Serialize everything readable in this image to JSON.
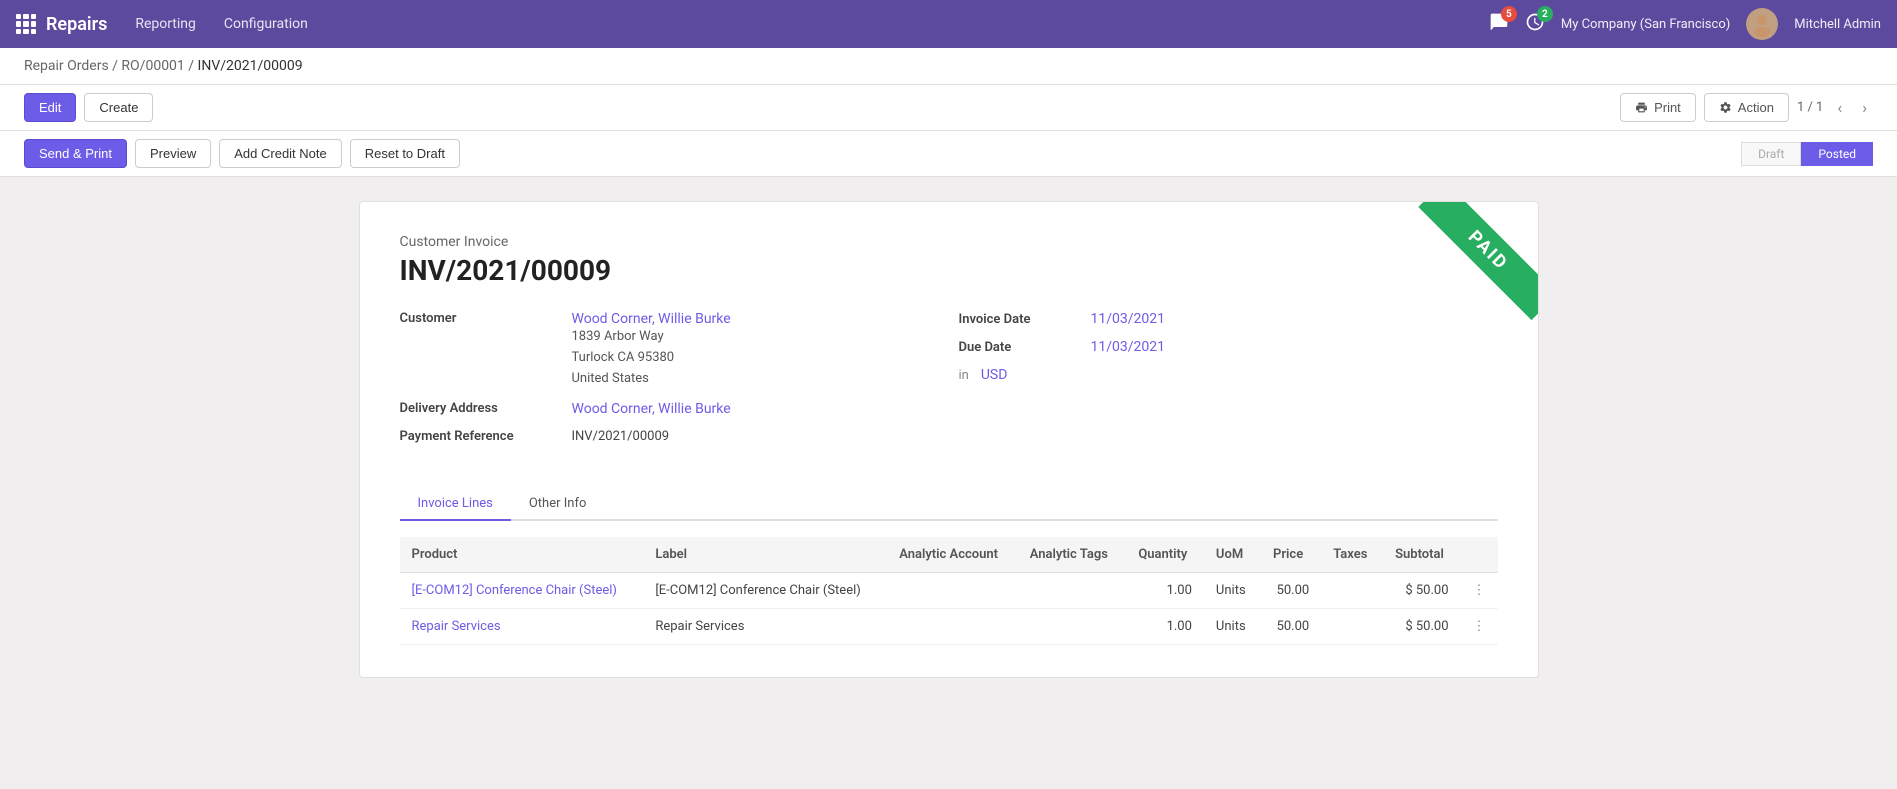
{
  "nav": {
    "app_name": "Repairs",
    "links": [
      "Reporting",
      "Configuration"
    ],
    "notifications": [
      {
        "icon": "chat",
        "count": 5,
        "badge_class": "badge"
      },
      {
        "icon": "clock",
        "count": 2,
        "badge_class": "badge badge-green"
      }
    ],
    "company": "My Company (San Francisco)",
    "user": "Mitchell Admin"
  },
  "breadcrumb": {
    "parts": [
      "Repair Orders",
      "RO/00001",
      "INV/2021/00009"
    ],
    "separators": [
      "/",
      "/"
    ]
  },
  "toolbar": {
    "edit_label": "Edit",
    "create_label": "Create",
    "print_label": "Print",
    "action_label": "Action",
    "pagination": "1 / 1"
  },
  "toolbar2": {
    "send_print_label": "Send & Print",
    "preview_label": "Preview",
    "add_credit_note_label": "Add Credit Note",
    "reset_to_draft_label": "Reset to Draft",
    "statuses": [
      "Draft",
      "Posted"
    ],
    "active_status": "Posted"
  },
  "invoice": {
    "type": "Customer Invoice",
    "number": "INV/2021/00009",
    "customer_label": "Customer",
    "customer_name": "Wood Corner, Willie Burke",
    "customer_address": "1839 Arbor Way\nTurlock CA 95380\nUnited States",
    "delivery_address_label": "Delivery Address",
    "delivery_address": "Wood Corner, Willie Burke",
    "payment_reference_label": "Payment Reference",
    "payment_reference": "INV/2021/00009",
    "invoice_date_label": "Invoice Date",
    "invoice_date": "11/03/2021",
    "due_date_label": "Due Date",
    "due_date": "11/03/2021",
    "currency_prefix": "in",
    "currency": "USD",
    "paid_label": "PAID"
  },
  "tabs": [
    "Invoice Lines",
    "Other Info"
  ],
  "active_tab": "Invoice Lines",
  "table": {
    "columns": [
      "Product",
      "Label",
      "Analytic Account",
      "Analytic Tags",
      "Quantity",
      "UoM",
      "Price",
      "Taxes",
      "Subtotal"
    ],
    "rows": [
      {
        "product": "[E-COM12] Conference Chair (Steel)",
        "label": "[E-COM12] Conference Chair (Steel)",
        "analytic_account": "",
        "analytic_tags": "",
        "quantity": "1.00",
        "uom": "Units",
        "price": "50.00",
        "taxes": "",
        "subtotal": "$ 50.00"
      },
      {
        "product": "Repair Services",
        "label": "Repair Services",
        "analytic_account": "",
        "analytic_tags": "",
        "quantity": "1.00",
        "uom": "Units",
        "price": "50.00",
        "taxes": "",
        "subtotal": "$ 50.00"
      }
    ]
  }
}
